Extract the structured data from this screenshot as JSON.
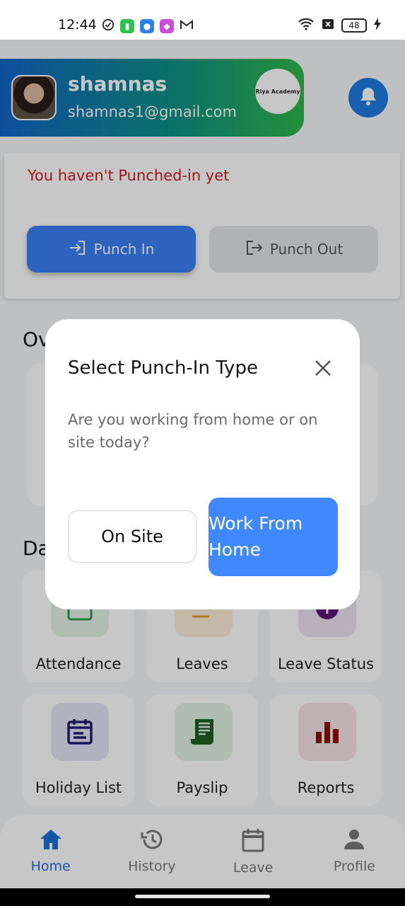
{
  "status_bar": {
    "time": "12:44",
    "battery": "48"
  },
  "profile": {
    "name": "shamnas",
    "email": "shamnas1@gmail.com",
    "logo_text": "Riya Academy"
  },
  "punch": {
    "message": "You haven't Punched-in yet",
    "punch_in_label": "Punch In",
    "punch_out_label": "Punch Out"
  },
  "sections": {
    "overview_partial": "Ov",
    "dashboard_partial": "Da"
  },
  "tiles": [
    {
      "label": "Attendance",
      "icon": "calendar-check-icon",
      "bg": "#e4f3e6",
      "fg": "#2e9c4a"
    },
    {
      "label": "Leaves",
      "icon": "leave-exit-icon",
      "bg": "#fbeed8",
      "fg": "#e09b25"
    },
    {
      "label": "Leave Status",
      "icon": "status-icon",
      "bg": "#eee2f3",
      "fg": "#5b1470"
    },
    {
      "label": "Holiday List",
      "icon": "calendar-icon",
      "bg": "#e3e5f6",
      "fg": "#1a1f6b"
    },
    {
      "label": "Payslip",
      "icon": "receipt-icon",
      "bg": "#e2f3e3",
      "fg": "#1f5f24"
    },
    {
      "label": "Reports",
      "icon": "bar-chart-icon",
      "bg": "#f6e4e4",
      "fg": "#8a1010"
    }
  ],
  "nav": [
    {
      "label": "Home",
      "icon": "home-icon"
    },
    {
      "label": "History",
      "icon": "history-icon"
    },
    {
      "label": "Leave",
      "icon": "calendar-icon"
    },
    {
      "label": "Profile",
      "icon": "person-icon"
    }
  ],
  "dialog": {
    "title": "Select Punch-In Type",
    "message": "Are you working from home or on site today?",
    "on_site_label": "On Site",
    "wfh_line1": "Work From",
    "wfh_line2": "Home"
  }
}
